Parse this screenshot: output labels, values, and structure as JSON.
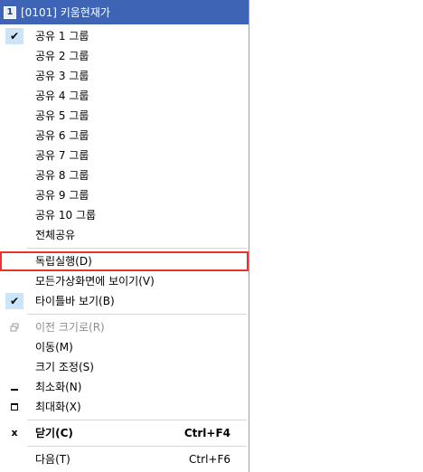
{
  "window": {
    "number": "1",
    "title": "[0101] 키움현재가"
  },
  "menu": {
    "groups": [
      {
        "label": "공유 1 그룹",
        "checked": true
      },
      {
        "label": "공유 2 그룹"
      },
      {
        "label": "공유 3 그룹"
      },
      {
        "label": "공유 4 그룹"
      },
      {
        "label": "공유 5 그룹"
      },
      {
        "label": "공유 6 그룹"
      },
      {
        "label": "공유 7 그룹"
      },
      {
        "label": "공유 8 그룹"
      },
      {
        "label": "공유 9 그룹"
      },
      {
        "label": "공유 10 그룹"
      },
      {
        "label": "전체공유"
      }
    ],
    "independent_run": "독립실행(D)",
    "show_all_screens": "모든가상화면에 보이기(V)",
    "show_titlebar": "타이틀바 보기(B)",
    "restore": "이전 크기로(R)",
    "move": "이동(M)",
    "resize": "크기 조정(S)",
    "minimize": "최소화(N)",
    "maximize": "최대화(X)",
    "close": {
      "label": "닫기(C)",
      "shortcut": "Ctrl+F4"
    },
    "next": {
      "label": "다음(T)",
      "shortcut": "Ctrl+F6"
    }
  }
}
